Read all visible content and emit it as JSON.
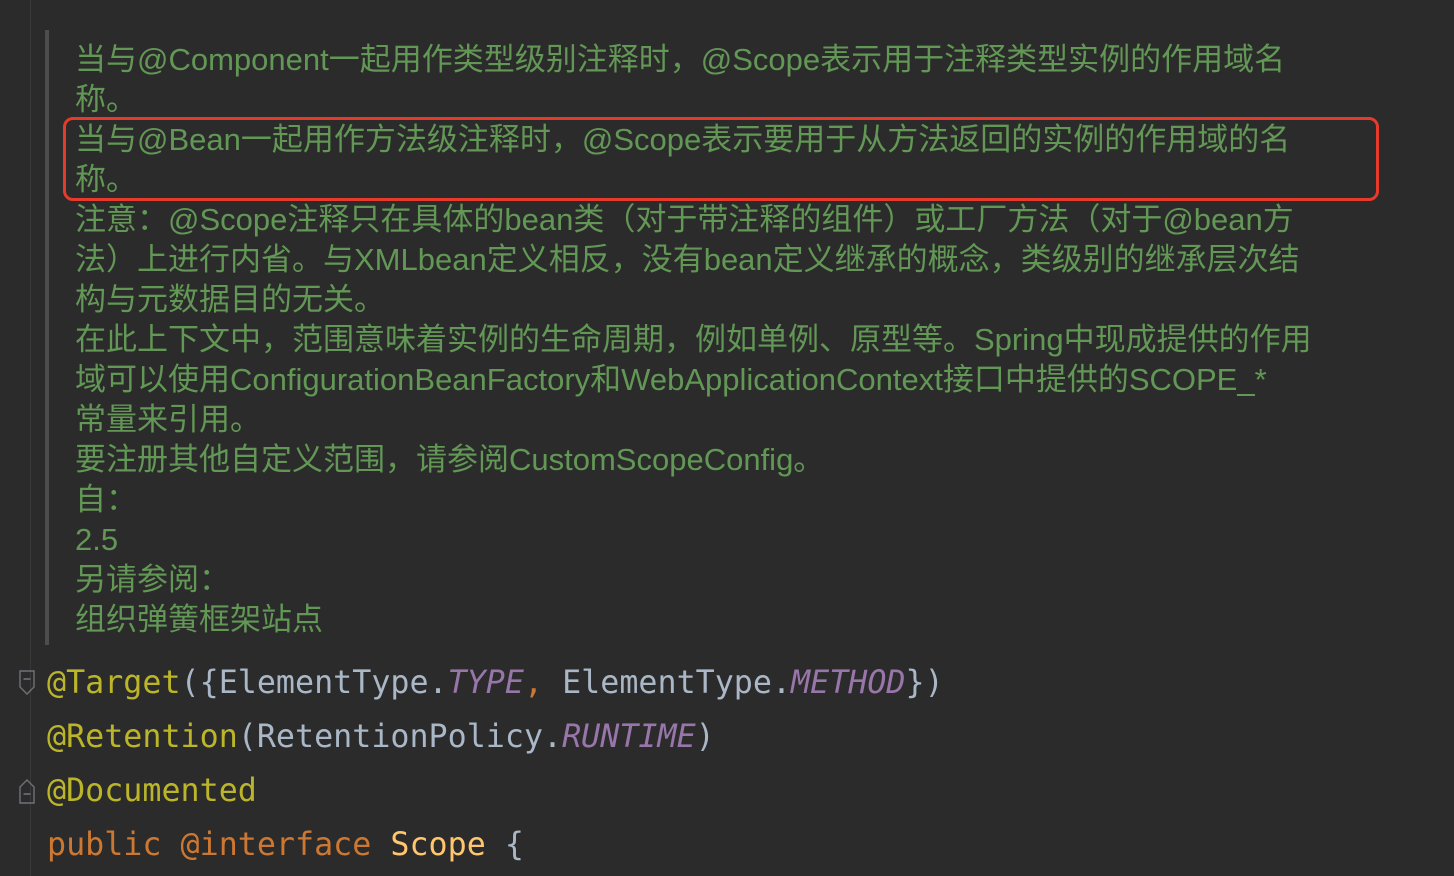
{
  "colors": {
    "background": "#2b2b2b",
    "doc_text": "#629755",
    "highlight_border": "#e63a2b",
    "annotation": "#bbb529",
    "keyword": "#cc7832",
    "constant": "#9876aa",
    "plain": "#a9b7c6",
    "class_name": "#ffc66d"
  },
  "icons": {
    "fold_start": "fold-start-icon",
    "fold_end": "fold-end-icon"
  },
  "doc": {
    "lines": [
      "当与@Component一起用作类型级别注释时，@Scope表示用于注释类型实例的作用域名",
      "称。",
      "当与@Bean一起用作方法级注释时，@Scope表示要用于从方法返回的实例的作用域的名",
      "称。",
      "注意：@Scope注释只在具体的bean类（对于带注释的组件）或工厂方法（对于@bean方",
      "法）上进行内省。与XMLbean定义相反，没有bean定义继承的概念，类级别的继承层次结",
      "构与元数据目的无关。",
      "在此上下文中，范围意味着实例的生命周期，例如单例、原型等。Spring中现成提供的作用",
      "域可以使用ConfigurationBeanFactory和WebApplicationContext接口中提供的SCOPE_*",
      "常量来引用。",
      "要注册其他自定义范围，请参阅CustomScopeConfig。",
      "自：",
      "2.5",
      "另请参阅：",
      "组织弹簧框架站点"
    ]
  },
  "code": {
    "line1": [
      "@Target",
      "({",
      "ElementType.",
      "TYPE",
      ",",
      " ElementType.",
      "METHOD",
      "})"
    ],
    "line2": [
      "@Retention",
      "(",
      "RetentionPolicy.",
      "RUNTIME",
      ")"
    ],
    "line3": [
      "@Documented"
    ],
    "line4": [
      "public",
      " @interface",
      " Scope",
      " {"
    ]
  }
}
